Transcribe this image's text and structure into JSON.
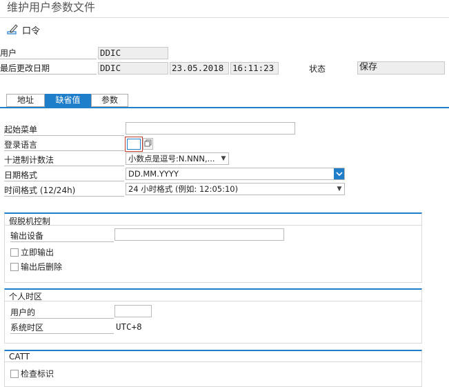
{
  "window": {
    "title": "维护用户参数文件"
  },
  "toolbar": {
    "password_label": "口令"
  },
  "header": {
    "user_label": "用户",
    "user_value": "DDIC",
    "last_changed_label": "最后更改日期",
    "changed_by": "DDIC",
    "changed_date": "23.05.2018",
    "changed_time": "16:11:23",
    "status_label": "状态",
    "status_value": "保存"
  },
  "tabs": [
    {
      "label": "地址",
      "active": false
    },
    {
      "label": "缺省值",
      "active": true
    },
    {
      "label": "参数",
      "active": false
    }
  ],
  "defaults": {
    "start_menu_label": "起始菜单",
    "start_menu_value": "",
    "logon_lang_label": "登录语言",
    "logon_lang_value": "",
    "decimal_label": "十进制计数法",
    "decimal_value": "小数点是逗号:N.NNN,...",
    "date_format_label": "日期格式",
    "date_format_value": "DD.MM.YYYY",
    "time_format_label": "时间格式 (12/24h)",
    "time_format_value": "24 小时格式 (例如: 12:05:10)"
  },
  "spool": {
    "title": "假脱机控制",
    "output_device_label": "输出设备",
    "output_device_value": "",
    "output_immediately_label": "立即输出",
    "delete_after_output_label": "输出后删除"
  },
  "timezone": {
    "title": "个人时区",
    "user_label": "用户的",
    "user_value": "",
    "system_label": "系统时区",
    "system_value": "UTC+8"
  },
  "catt": {
    "title": "CATT",
    "check_flag_label": "检查标识"
  },
  "colors": {
    "accent": "#1f7ec9",
    "readonly_bg": "#eeeeee"
  }
}
